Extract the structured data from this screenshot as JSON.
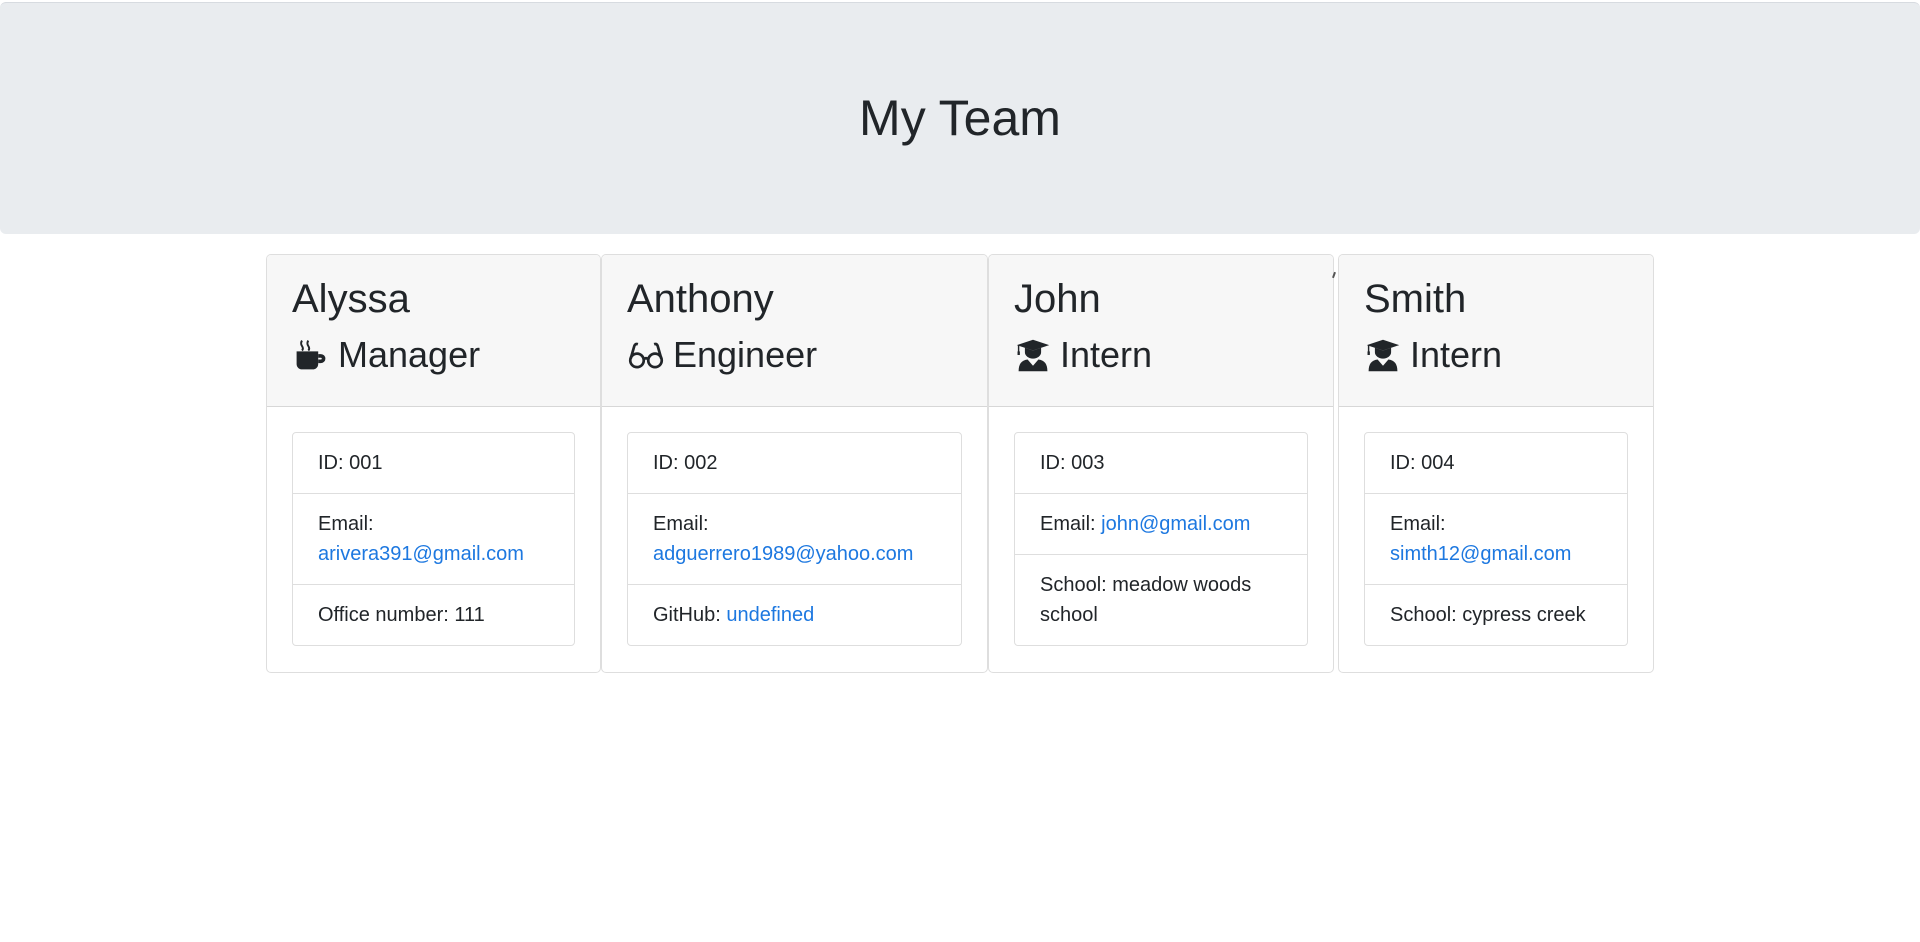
{
  "header": {
    "title": "My Team"
  },
  "team": [
    {
      "name": "Alyssa",
      "role": "Manager",
      "icon": "coffee-icon",
      "id_text": "ID: 001",
      "email_label": "Email:",
      "email": "arivera391@gmail.com",
      "extra_label": "Office number: 111",
      "extra_link": ""
    },
    {
      "name": "Anthony",
      "role": "Engineer",
      "icon": "glasses-icon",
      "id_text": "ID: 002",
      "email_label": "Email:",
      "email": "adguerrero1989@yahoo.com",
      "extra_label": "GitHub:",
      "extra_link": "undefined"
    },
    {
      "name": "John",
      "role": "Intern",
      "icon": "graduate-icon",
      "id_text": "ID: 003",
      "email_label": "Email:",
      "email": "john@gmail.com",
      "extra_label": "School: meadow woods school",
      "extra_link": ""
    },
    {
      "name": "Smith",
      "role": "Intern",
      "icon": "graduate-icon",
      "id_text": "ID: 004",
      "email_label": "Email:",
      "email": "simth12@gmail.com",
      "extra_label": "School: cypress creek",
      "extra_link": ""
    }
  ],
  "colors": {
    "link": "#1d78e0",
    "header_bg": "#e9ecef",
    "card_header_bg": "#f7f7f7"
  }
}
